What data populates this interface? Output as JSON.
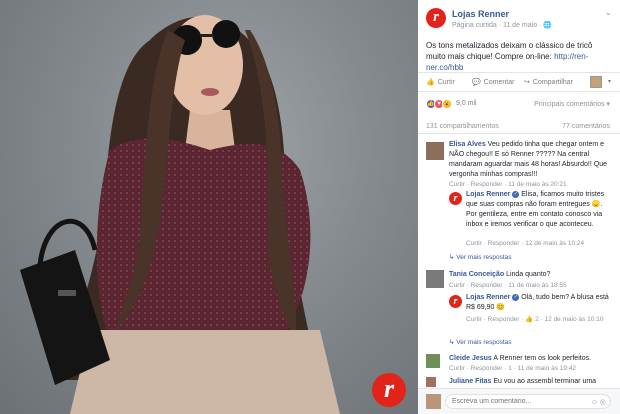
{
  "brand": {
    "accent": "#e2231a",
    "link": "#365899",
    "muted": "#90949c",
    "logo_glyph": "r"
  },
  "post": {
    "page_name": "Lojas Renner",
    "meta": "Página curtida · 11 de maio · 🌐",
    "text": "Os tons metalizados deixam o clássico de tricô muito mais chique! Compre on-line:",
    "link": "http://ren-ner.co/hbb"
  },
  "actions": {
    "like": "Curtir",
    "comment": "Comentar",
    "share": "Compartilhar",
    "dropdown": "▾"
  },
  "reactions": {
    "count": "9,0 mil",
    "sort": "Principais comentários ▾",
    "colors": [
      "#4267b2",
      "#f25268",
      "#f7b125"
    ]
  },
  "counts": {
    "shares": "131 compartilhamentos",
    "comments": "77 comentários"
  },
  "comments": [
    {
      "author": "Elisa Alves",
      "text": "Veu pedido tinha que chegar ontem e NÃO chegou!! E só Renner ????? Na central mandaram aguardar mais 48 horas! Absurdo!! Que vergonha minhas compras!!!",
      "meta": "Curtir · Responder · 11 de maio às 20:21"
    },
    {
      "author": "Lojas Renner",
      "text": "Elisa, ficamos muito tristes que suas compras não foram entregues 😞. Por gentileza, entre em contato conosco via inbox e iremos verificar o que aconteceu.",
      "meta": "Curtir · Responder · 12 de maio às 10:24"
    },
    {
      "more": "↳ Ver mais respostas"
    },
    {
      "author": "Tania Conceição",
      "text": "Linda quanto?",
      "meta": "Curtir · Responder · 11 de maio às 18:55"
    },
    {
      "author": "Lojas Renner",
      "text": "Olá, tudo bem? A blusa está R$ 69,90 😊",
      "meta": "Curtir · Responder · 👍 2 · 12 de maio às 10:10"
    },
    {
      "more": "↳ Ver mais respostas"
    },
    {
      "author": "Cleide Jesus",
      "text": "A Renner tem os look perfeitos.",
      "meta": "Curtir · Responder · 1 · 11 de maio às 19:42"
    },
    {
      "author": "Juliane Fitas",
      "text": "Eu vou ao assembl terminar uma",
      "meta": ""
    }
  ],
  "write": {
    "placeholder": "Escreva um comentário...",
    "camera": "☺ ◎"
  }
}
